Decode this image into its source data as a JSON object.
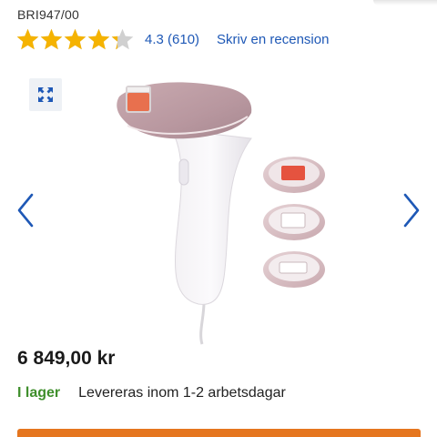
{
  "product": {
    "sku": "BRI947/00",
    "rating": {
      "value": 4.3,
      "max": 5,
      "text": "4.3 (610)",
      "review_link": "Skriv en recension",
      "star_color": "#f5b301",
      "empty_star_color": "#d0d0d0"
    },
    "price": "6 849,00 kr",
    "stock_status": "I lager",
    "delivery_text": "Levereras inom 1-2 arbetsdagar"
  },
  "gallery": {
    "expand_icon": "expand-arrows-icon",
    "prev_icon": "chevron-left-icon",
    "next_icon": "chevron-right-icon",
    "image": "ipl-hair-removal-device-with-attachments"
  },
  "colors": {
    "link": "#1e58b6",
    "stock": "#3f8f2c",
    "cta": "#e5761f",
    "arrow": "#1e58b6"
  }
}
